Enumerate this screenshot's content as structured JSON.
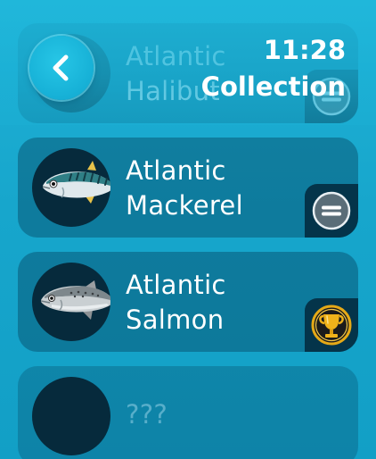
{
  "status_bar": {
    "time": "11:28"
  },
  "header": {
    "title": "Collection"
  },
  "collection": [
    {
      "name": "Atlantic\nHalibut",
      "status": "neutral",
      "status_icon": "equals-icon"
    },
    {
      "name": "Atlantic\nMackerel",
      "status": "neutral",
      "status_icon": "equals-icon"
    },
    {
      "name": "Atlantic\nSalmon",
      "status": "best",
      "status_icon": "trophy-icon"
    },
    {
      "name": "???",
      "status": "locked"
    }
  ],
  "colors": {
    "background": "#1ab0d6",
    "card": "#1d6f8f",
    "thumb": "#062a3c",
    "trophy": "#f0b21a"
  }
}
